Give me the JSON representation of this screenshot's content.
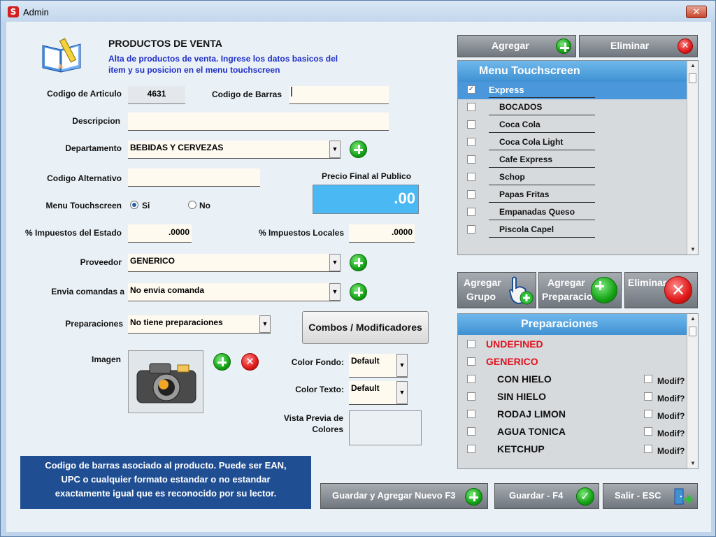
{
  "window": {
    "title": "Admin",
    "app_icon": "S",
    "close_label": "✕"
  },
  "header": {
    "title": "PRODUCTOS DE VENTA",
    "subtitle_line1": "Alta de productos de venta. Ingrese los datos basicos del",
    "subtitle_line2": "item y su posicion en el menu touchscreen"
  },
  "form": {
    "codigo_articulo_label": "Codigo de Articulo",
    "codigo_articulo_value": "4631",
    "codigo_barras_label": "Codigo de Barras",
    "codigo_barras_value": "",
    "descripcion_label": "Descripcion",
    "descripcion_value": "",
    "departamento_label": "Departamento",
    "departamento_value": "BEBIDAS Y CERVEZAS",
    "codigo_alternativo_label": "Codigo Alternativo",
    "codigo_alternativo_value": "",
    "precio_label": "Precio Final al Publico",
    "precio_value": ".00",
    "menu_touch_label": "Menu Touchscreen",
    "menu_touch_si": "Si",
    "menu_touch_no": "No",
    "impuestos_estado_label": "% Impuestos del Estado",
    "impuestos_estado_value": ".0000",
    "impuestos_locales_label": "% Impuestos Locales",
    "impuestos_locales_value": ".0000",
    "proveedor_label": "Proveedor",
    "proveedor_value": "GENERICO",
    "envia_label": "Envia comandas a",
    "envia_value": "No envia comanda",
    "preparaciones_label": "Preparaciones",
    "preparaciones_value": "No tiene preparaciones",
    "combos_button": "Combos /  Modificadores",
    "imagen_label": "Imagen",
    "color_fondo_label": "Color Fondo:",
    "color_fondo_value": "Default",
    "color_texto_label": "Color Texto:",
    "color_texto_value": "Default",
    "vista_previa_label1": "Vista Previa de",
    "vista_previa_label2": "Colores"
  },
  "help": {
    "line1": "Codigo de barras asociado al producto. Puede ser EAN,",
    "line2": "UPC o cualquier formato estandar o no estandar",
    "line3": "exactamente igual que es reconocido por su lector."
  },
  "menu_panel": {
    "agregar_label": "Agregar",
    "eliminar_label": "Eliminar",
    "title": "Menu Touchscreen",
    "items": [
      {
        "label": "Express",
        "checked": true
      },
      {
        "label": "BOCADOS",
        "checked": false
      },
      {
        "label": "Coca Cola",
        "checked": false
      },
      {
        "label": "Coca Cola Light",
        "checked": false
      },
      {
        "label": "Cafe Express",
        "checked": false
      },
      {
        "label": "Schop",
        "checked": false
      },
      {
        "label": "Papas Fritas",
        "checked": false
      },
      {
        "label": "Empanadas Queso",
        "checked": false
      },
      {
        "label": "Piscola Capel",
        "checked": false
      }
    ]
  },
  "prep_panel": {
    "agregar_grupo_line1": "Agregar",
    "agregar_grupo_line2": "Grupo",
    "agregar_prep_line1": "Agregar",
    "agregar_prep_line2": "Preparacio",
    "eliminar_label": "Eliminar",
    "title": "Preparaciones",
    "modif_label": "Modif?",
    "groups": [
      {
        "label": "UNDEFINED"
      },
      {
        "label": "GENERICO"
      }
    ],
    "items": [
      {
        "label": "CON HIELO"
      },
      {
        "label": "SIN HIELO"
      },
      {
        "label": "RODAJ LIMON"
      },
      {
        "label": "AGUA TONICA"
      },
      {
        "label": "KETCHUP"
      }
    ]
  },
  "footer": {
    "guardar_nuevo": "Guardar y Agregar Nuevo F3",
    "guardar": "Guardar - F4",
    "salir": "Salir - ESC"
  },
  "colors": {
    "accent_blue": "#3f91d3",
    "help_bg": "#1f4e93",
    "price_bg": "#4ab8f3",
    "red_text": "#e0121e"
  },
  "icons": [
    "app-icon",
    "close-icon",
    "book-pencil-icon",
    "plus-icon",
    "delete-icon",
    "camera-icon",
    "hand-plus-icon",
    "checkmark-icon",
    "exit-door-icon",
    "chevron-down-icon"
  ]
}
